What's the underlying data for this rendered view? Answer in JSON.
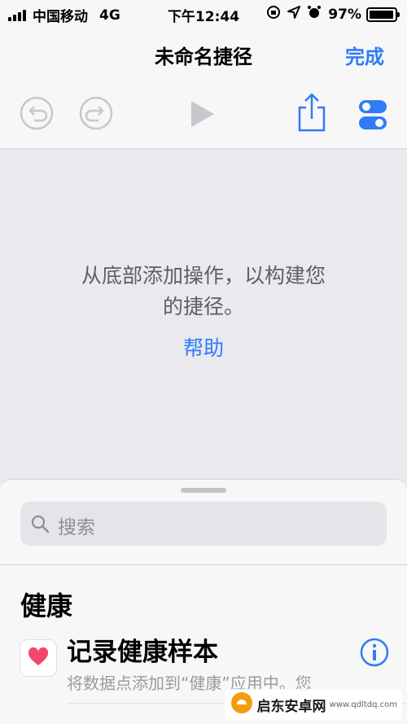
{
  "status_bar": {
    "carrier": "中国移动",
    "network": "4G",
    "time": "下午12:44",
    "battery_text": "97%",
    "battery_level": 0.97,
    "icons": [
      "lock-rotation-icon",
      "location-icon",
      "alarm-icon"
    ]
  },
  "nav": {
    "title": "未命名捷径",
    "done_label": "完成"
  },
  "toolbar": {
    "icons": [
      "undo-icon",
      "redo-icon",
      "play-icon",
      "share-icon",
      "settings-toggle-icon"
    ],
    "accent": "#2f7cf6",
    "disabled": "#c7c7cc"
  },
  "empty_state": {
    "line1": "从底部添加操作，以构建您",
    "line2": "的捷径。",
    "help_link": "帮助"
  },
  "action_sheet": {
    "search_placeholder": "搜索",
    "section_title": "健康",
    "actions": [
      {
        "name": "记录健康样本",
        "description": "将数据点添加到“健康”应用中。您",
        "icon": "heart-icon"
      }
    ]
  },
  "watermark": {
    "text": "启东安卓网",
    "sub": "www.qdltdq.com"
  }
}
